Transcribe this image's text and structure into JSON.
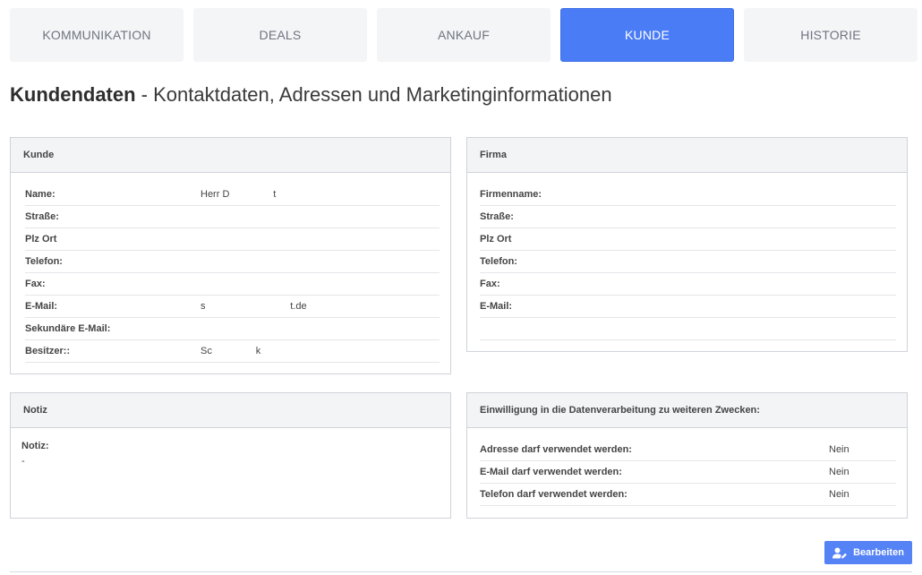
{
  "tabs": [
    {
      "label": "KOMMUNIKATION"
    },
    {
      "label": "DEALS"
    },
    {
      "label": "ANKAUF"
    },
    {
      "label": "KUNDE"
    },
    {
      "label": "HISTORIE"
    }
  ],
  "active_tab": "KUNDE",
  "page_title": {
    "bold": "Kundendaten",
    "rest": " - Kontaktdaten, Adressen und Marketinginformationen"
  },
  "kunde": {
    "title": "Kunde",
    "rows": [
      {
        "label": "Name:",
        "value": "Herr D                t"
      },
      {
        "label": "Straße:",
        "value": ""
      },
      {
        "label": "Plz Ort",
        "value": ""
      },
      {
        "label": "Telefon:",
        "value": ""
      },
      {
        "label": "Fax:",
        "value": ""
      },
      {
        "label": "E-Mail:",
        "value": "s                               t.de"
      },
      {
        "label": "Sekundäre E-Mail:",
        "value": ""
      },
      {
        "label": "Besitzer::",
        "value": "Sc                k"
      }
    ]
  },
  "firma": {
    "title": "Firma",
    "rows": [
      {
        "label": "Firmenname:",
        "value": ""
      },
      {
        "label": "Straße:",
        "value": ""
      },
      {
        "label": "Plz Ort",
        "value": ""
      },
      {
        "label": "Telefon:",
        "value": ""
      },
      {
        "label": "Fax:",
        "value": ""
      },
      {
        "label": "E-Mail:",
        "value": ""
      }
    ]
  },
  "notiz": {
    "title": "Notiz",
    "label": "Notiz:",
    "value": "-"
  },
  "consent": {
    "title": "Einwilligung in die Datenverarbeitung zu weiteren Zwecken:",
    "rows": [
      {
        "label": "Adresse darf verwendet werden:",
        "value": "Nein"
      },
      {
        "label": "E-Mail darf verwendet werden:",
        "value": "Nein"
      },
      {
        "label": "Telefon darf verwendet werden:",
        "value": "Nein"
      }
    ]
  },
  "edit_button": {
    "label": "Bearbeiten",
    "icon": "user-edit-icon"
  },
  "colors": {
    "accent": "#4a7cf6",
    "button": "#5582f5"
  }
}
